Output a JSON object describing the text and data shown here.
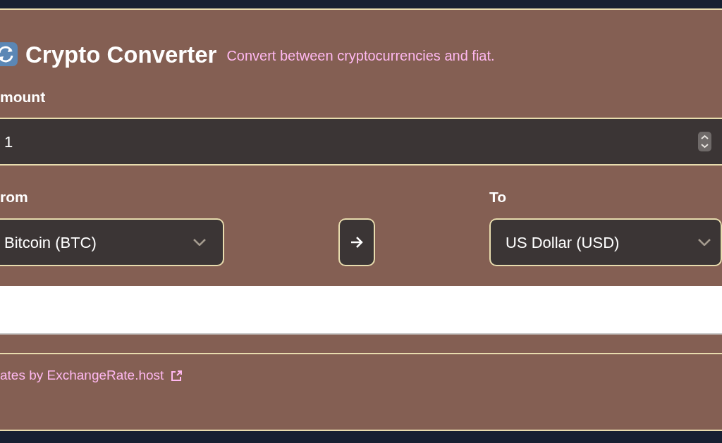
{
  "header": {
    "title": "Crypto Converter",
    "subtitle": "Convert between cryptocurrencies and fiat."
  },
  "amount": {
    "label": "mount",
    "value": "1"
  },
  "from": {
    "label": "rom",
    "value": "Bitcoin (BTC)"
  },
  "to": {
    "label": "To",
    "value": "US Dollar (USD)"
  },
  "footer": {
    "link": "ates by ExchangeRate.host"
  }
}
